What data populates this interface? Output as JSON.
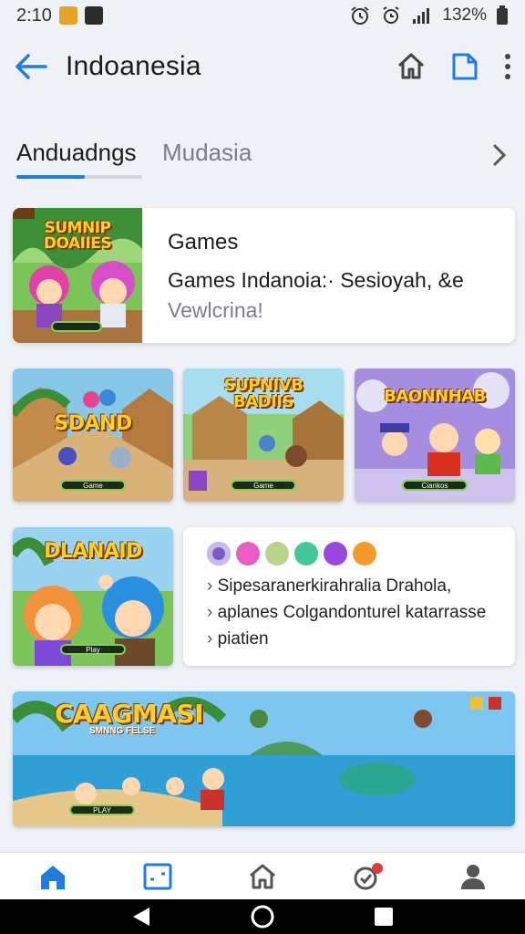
{
  "status_bar": {
    "time": "2:10",
    "battery": "132%",
    "icons": [
      "notification-orange-icon",
      "notification-dark-icon",
      "alarm-icon",
      "alarm-clock-icon",
      "signal-icon",
      "battery-icon"
    ]
  },
  "app_bar": {
    "title": "Indoanesia",
    "back_icon": "back-arrow-icon",
    "actions": [
      "home-icon",
      "bookmark-icon",
      "more-vert-icon"
    ]
  },
  "tabs": {
    "items": [
      {
        "label": "Anduadngs",
        "active": true
      },
      {
        "label": "Mudasia",
        "active": false
      }
    ],
    "progress": 0.54,
    "accent": "#1f7de0"
  },
  "featured": {
    "thumb_title": "SUMNIP DOAIIES",
    "heading": "Games",
    "subtitle": "Games Indanoia:·  Sesioyah, &e",
    "subtitle2": "Vewlcrina!"
  },
  "row_thumbs": [
    {
      "title": "SDAND",
      "button": "Game"
    },
    {
      "title": "SUPNIVB BADIIS",
      "button": "Game"
    },
    {
      "title": "BAONNHAB",
      "button": "Ciankos"
    }
  ],
  "promo": {
    "thumb_title": "DLANAID",
    "button": "Play",
    "lines": [
      "Sipesaranerkirahralia Drahola,",
      "aplanes Colgandonturel katarrasse",
      "piatien"
    ]
  },
  "banner": {
    "title": "CAAGMASI",
    "subtitle": "SMNNG FELSE",
    "button": "PLAY"
  },
  "bottom_nav": [
    "home-icon",
    "gallery-icon",
    "house-outline-icon",
    "badge-icon",
    "profile-icon"
  ],
  "system_nav": [
    "back-triangle-icon",
    "home-circle-icon",
    "recents-square-icon"
  ],
  "colors": {
    "background": "#eef1f6",
    "accent": "#1f7de0",
    "card": "#ffffff"
  }
}
